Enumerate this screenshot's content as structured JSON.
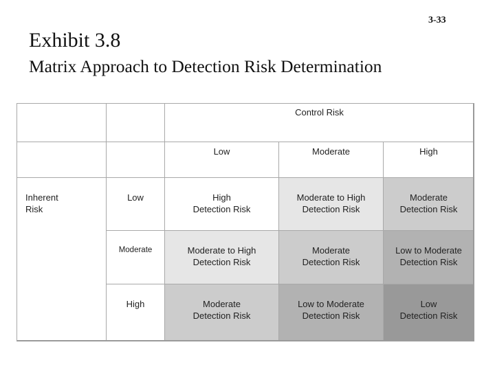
{
  "page_number": "3-33",
  "title": "Exhibit 3.8",
  "subtitle": "Matrix Approach to Detection Risk Determination",
  "matrix": {
    "column_group_label": "Control Risk",
    "row_group_label": [
      "Inherent",
      "Risk"
    ],
    "control_risk_levels": [
      "Low",
      "Moderate",
      "High"
    ],
    "inherent_risk_levels": [
      "Low",
      "Moderate",
      "High"
    ],
    "cells": [
      [
        {
          "line1": "High",
          "line2": "Detection Risk",
          "shade": "#ffffff"
        },
        {
          "line1": "Moderate to High",
          "line2": "Detection Risk",
          "shade": "#e6e6e6"
        },
        {
          "line1": "Moderate",
          "line2": "Detection Risk",
          "shade": "#cccccc"
        }
      ],
      [
        {
          "line1": "Moderate to High",
          "line2": "Detection Risk",
          "shade": "#e6e6e6"
        },
        {
          "line1": "Moderate",
          "line2": "Detection Risk",
          "shade": "#cccccc"
        },
        {
          "line1": "Low to Moderate",
          "line2": "Detection Risk",
          "shade": "#b2b2b2"
        }
      ],
      [
        {
          "line1": "Moderate",
          "line2": "Detection Risk",
          "shade": "#cccccc"
        },
        {
          "line1": "Low to Moderate",
          "line2": "Detection Risk",
          "shade": "#b2b2b2"
        },
        {
          "line1": "Low",
          "line2": "Detection Risk",
          "shade": "#999999"
        }
      ]
    ]
  }
}
